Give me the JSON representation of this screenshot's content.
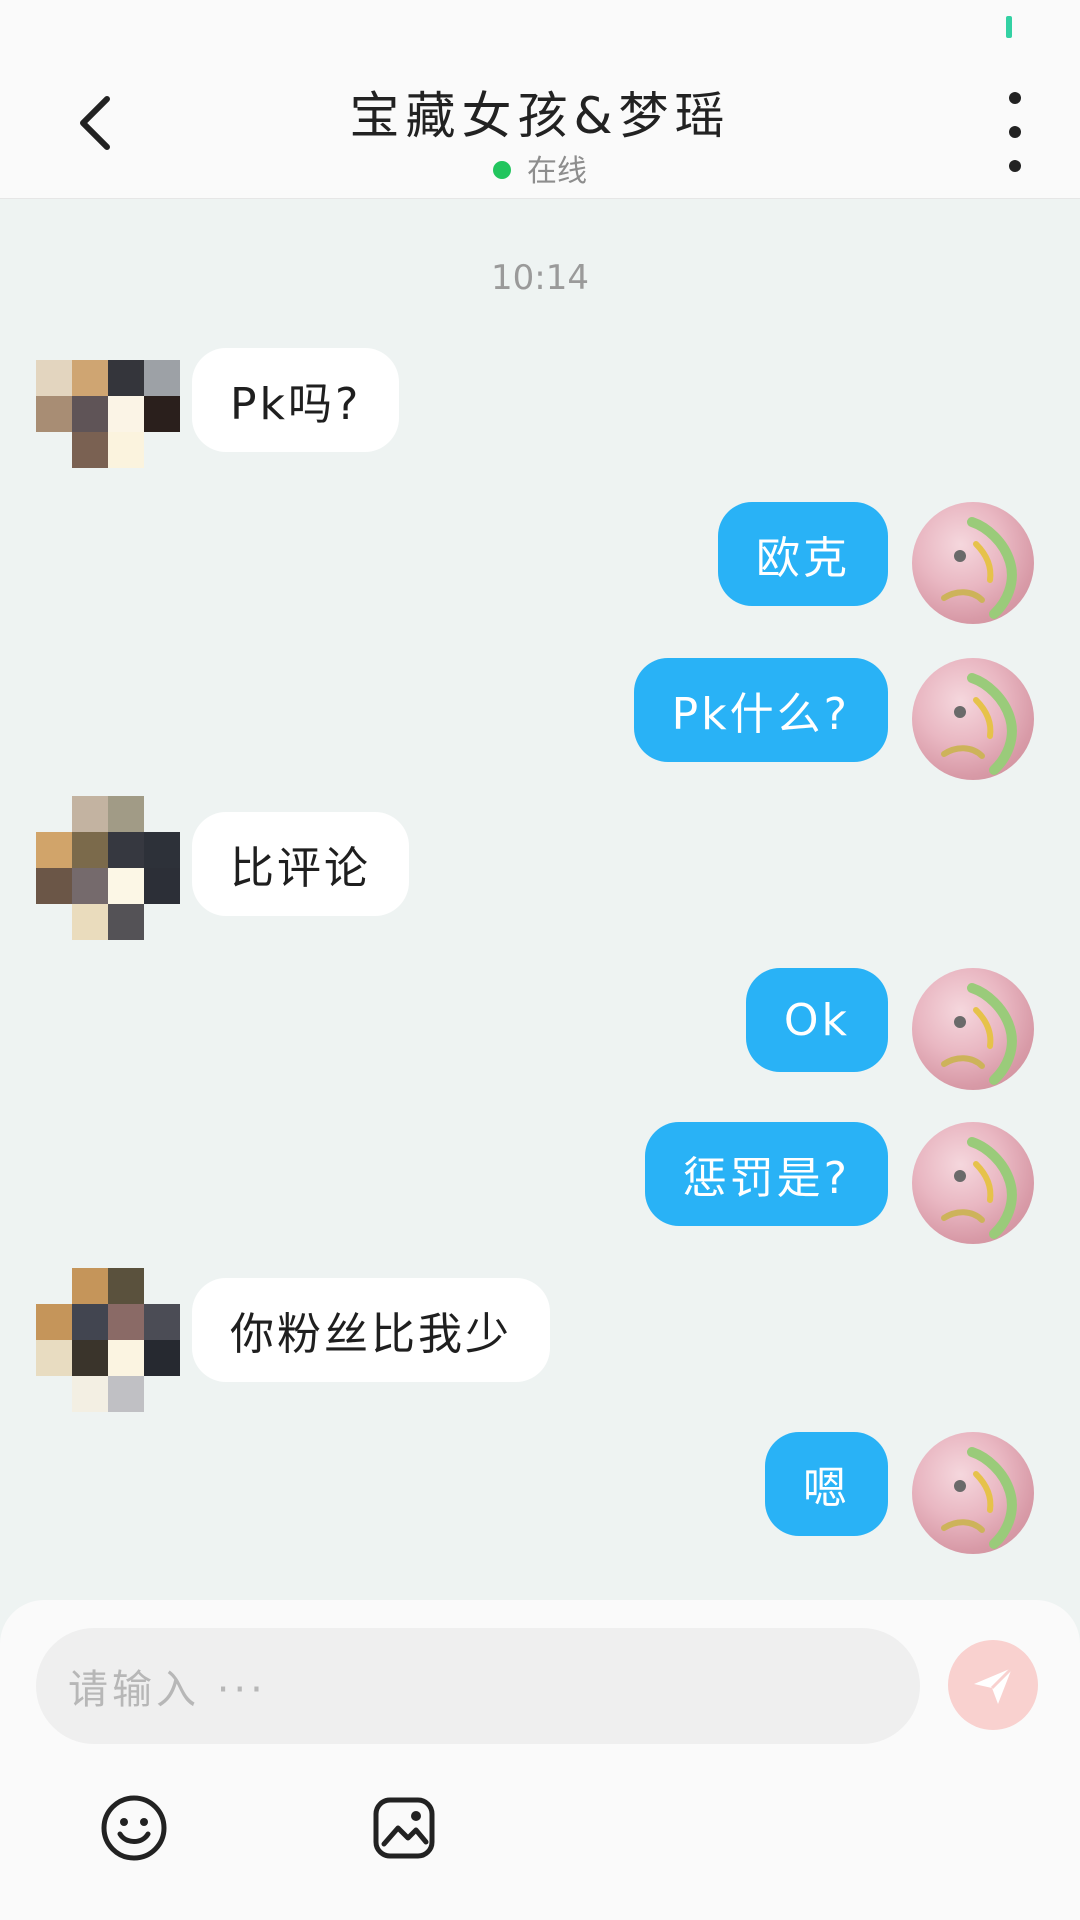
{
  "header": {
    "title": "宝藏女孩&梦瑶",
    "status": "在线"
  },
  "chat": {
    "timestamp": "10:14",
    "messages": [
      {
        "side": "in",
        "text": "Pk吗?"
      },
      {
        "side": "out",
        "text": "欧克"
      },
      {
        "side": "out",
        "text": "Pk什么?"
      },
      {
        "side": "in",
        "text": "比评论"
      },
      {
        "side": "out",
        "text": "Ok"
      },
      {
        "side": "out",
        "text": "惩罚是?"
      },
      {
        "side": "in",
        "text": "你粉丝比我少"
      },
      {
        "side": "out",
        "text": "嗯"
      }
    ]
  },
  "composer": {
    "placeholder": "请输入 ···"
  },
  "colors": {
    "accent_blue": "#29b2f6",
    "online_green": "#22c55e",
    "send_disabled": "#f9d1cf"
  },
  "icons": {
    "back": "chevron-left-icon",
    "more": "more-vertical-icon",
    "send": "paper-plane-icon",
    "emoji": "smile-icon",
    "image": "image-icon"
  }
}
